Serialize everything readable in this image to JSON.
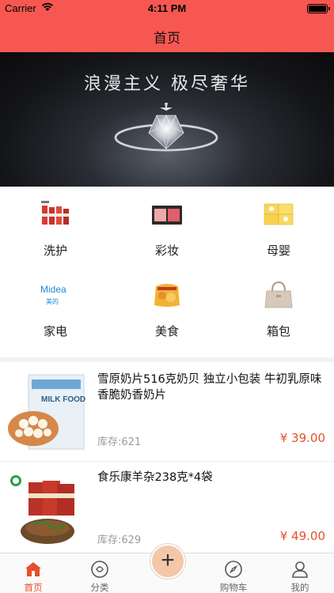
{
  "status_bar": {
    "carrier": "Carrier",
    "time": "4:11 PM"
  },
  "nav": {
    "title": "首页"
  },
  "banner": {
    "slogan": "浪漫主义 极尽奢华",
    "page_count": 4,
    "active_page": 1
  },
  "categories": [
    {
      "label": "洗护",
      "icon": "skincare-tubes-icon"
    },
    {
      "label": "彩妆",
      "icon": "makeup-palette-icon"
    },
    {
      "label": "母婴",
      "icon": "baby-products-icon"
    },
    {
      "label": "家电",
      "icon": "midea-logo-icon",
      "logo_text": "Midea",
      "logo_sub": "美的"
    },
    {
      "label": "美食",
      "icon": "snack-bag-icon"
    },
    {
      "label": "箱包",
      "icon": "handbag-icon"
    }
  ],
  "products": [
    {
      "title": "雪原奶片516克奶贝 独立小包装 牛初乳原味香脆奶香奶片",
      "stock": "库存:621",
      "price": "¥ 39.00",
      "image": "milk-tablets-image",
      "image_text": "MILK FOOD"
    },
    {
      "title": "食乐康羊杂238克*4袋",
      "stock": "库存:629",
      "price": "¥ 49.00",
      "image": "lamb-offal-image"
    }
  ],
  "tabbar": {
    "tabs": [
      {
        "label": "首页",
        "icon": "home-icon",
        "active": true
      },
      {
        "label": "分类",
        "icon": "category-icon",
        "active": false
      },
      {
        "label": "",
        "icon": "plus-icon",
        "active": false
      },
      {
        "label": "购物车",
        "icon": "compass-icon",
        "active": false
      },
      {
        "label": "我的",
        "icon": "user-icon",
        "active": false
      }
    ],
    "plus_symbol": "+"
  },
  "colors": {
    "nav_bg": "#f65851",
    "accent": "#e5502b",
    "stock_text": "#9a9a9a"
  }
}
